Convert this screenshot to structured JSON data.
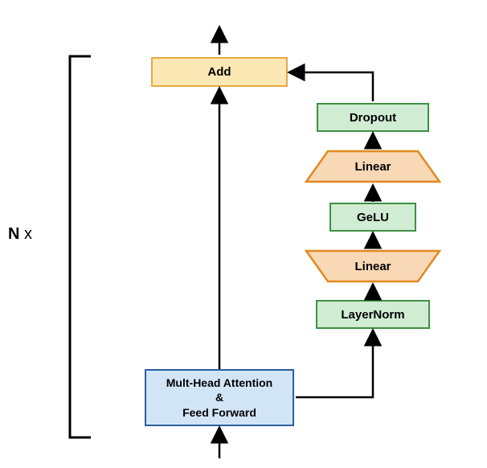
{
  "repeat_label_bold": "N",
  "repeat_label_suffix": " x",
  "blocks": {
    "add": "Add",
    "dropout": "Dropout",
    "linear1": "Linear",
    "gelu": "GeLU",
    "linear2": "Linear",
    "layernorm": "LayerNorm",
    "attention_ffn_line1": "Mult-Head Attention",
    "attention_ffn_line2": "&",
    "attention_ffn_line3": "Feed Forward"
  },
  "colors": {
    "add_fill": "#fce8b4",
    "add_border": "#e6a94a",
    "green_fill": "#d0ecd3",
    "green_border": "#3f8f44",
    "blue_fill": "#d2e5f7",
    "blue_border": "#2b5ea1",
    "linear_fill": "#f9d8b6",
    "linear_border": "#e08a1f",
    "arrow": "#000000",
    "bracket": "#000000"
  },
  "chart_data": {
    "type": "diagram",
    "description": "Transformer-like block repeated N times. Input goes into Mult-Head Attention & Feed Forward block; its output goes (a) directly up to Add (residual) and (b) into a feed-forward branch: LayerNorm → Linear (expand) → GeLU → Linear (contract) → Dropout → Add. Add output exits at top. Whole structure bracketed and annotated 'N x'.",
    "nodes": [
      {
        "id": "input",
        "label": "",
        "type": "arrow-in"
      },
      {
        "id": "attn_ffn",
        "label": "Mult-Head Attention & Feed Forward",
        "color": "blue"
      },
      {
        "id": "layernorm",
        "label": "LayerNorm",
        "color": "green"
      },
      {
        "id": "linear_expand",
        "label": "Linear",
        "color": "orange",
        "shape": "trapezoid-up"
      },
      {
        "id": "gelu",
        "label": "GeLU",
        "color": "green"
      },
      {
        "id": "linear_contract",
        "label": "Linear",
        "color": "orange",
        "shape": "trapezoid-down"
      },
      {
        "id": "dropout",
        "label": "Dropout",
        "color": "green"
      },
      {
        "id": "add",
        "label": "Add",
        "color": "yellow"
      },
      {
        "id": "output",
        "label": "",
        "type": "arrow-out"
      }
    ],
    "edges": [
      {
        "from": "input",
        "to": "attn_ffn"
      },
      {
        "from": "attn_ffn",
        "to": "add",
        "note": "residual"
      },
      {
        "from": "attn_ffn",
        "to": "layernorm"
      },
      {
        "from": "layernorm",
        "to": "linear_expand"
      },
      {
        "from": "linear_expand",
        "to": "gelu"
      },
      {
        "from": "gelu",
        "to": "linear_contract"
      },
      {
        "from": "linear_contract",
        "to": "dropout"
      },
      {
        "from": "dropout",
        "to": "add"
      },
      {
        "from": "add",
        "to": "output"
      }
    ],
    "repeat": "N"
  }
}
